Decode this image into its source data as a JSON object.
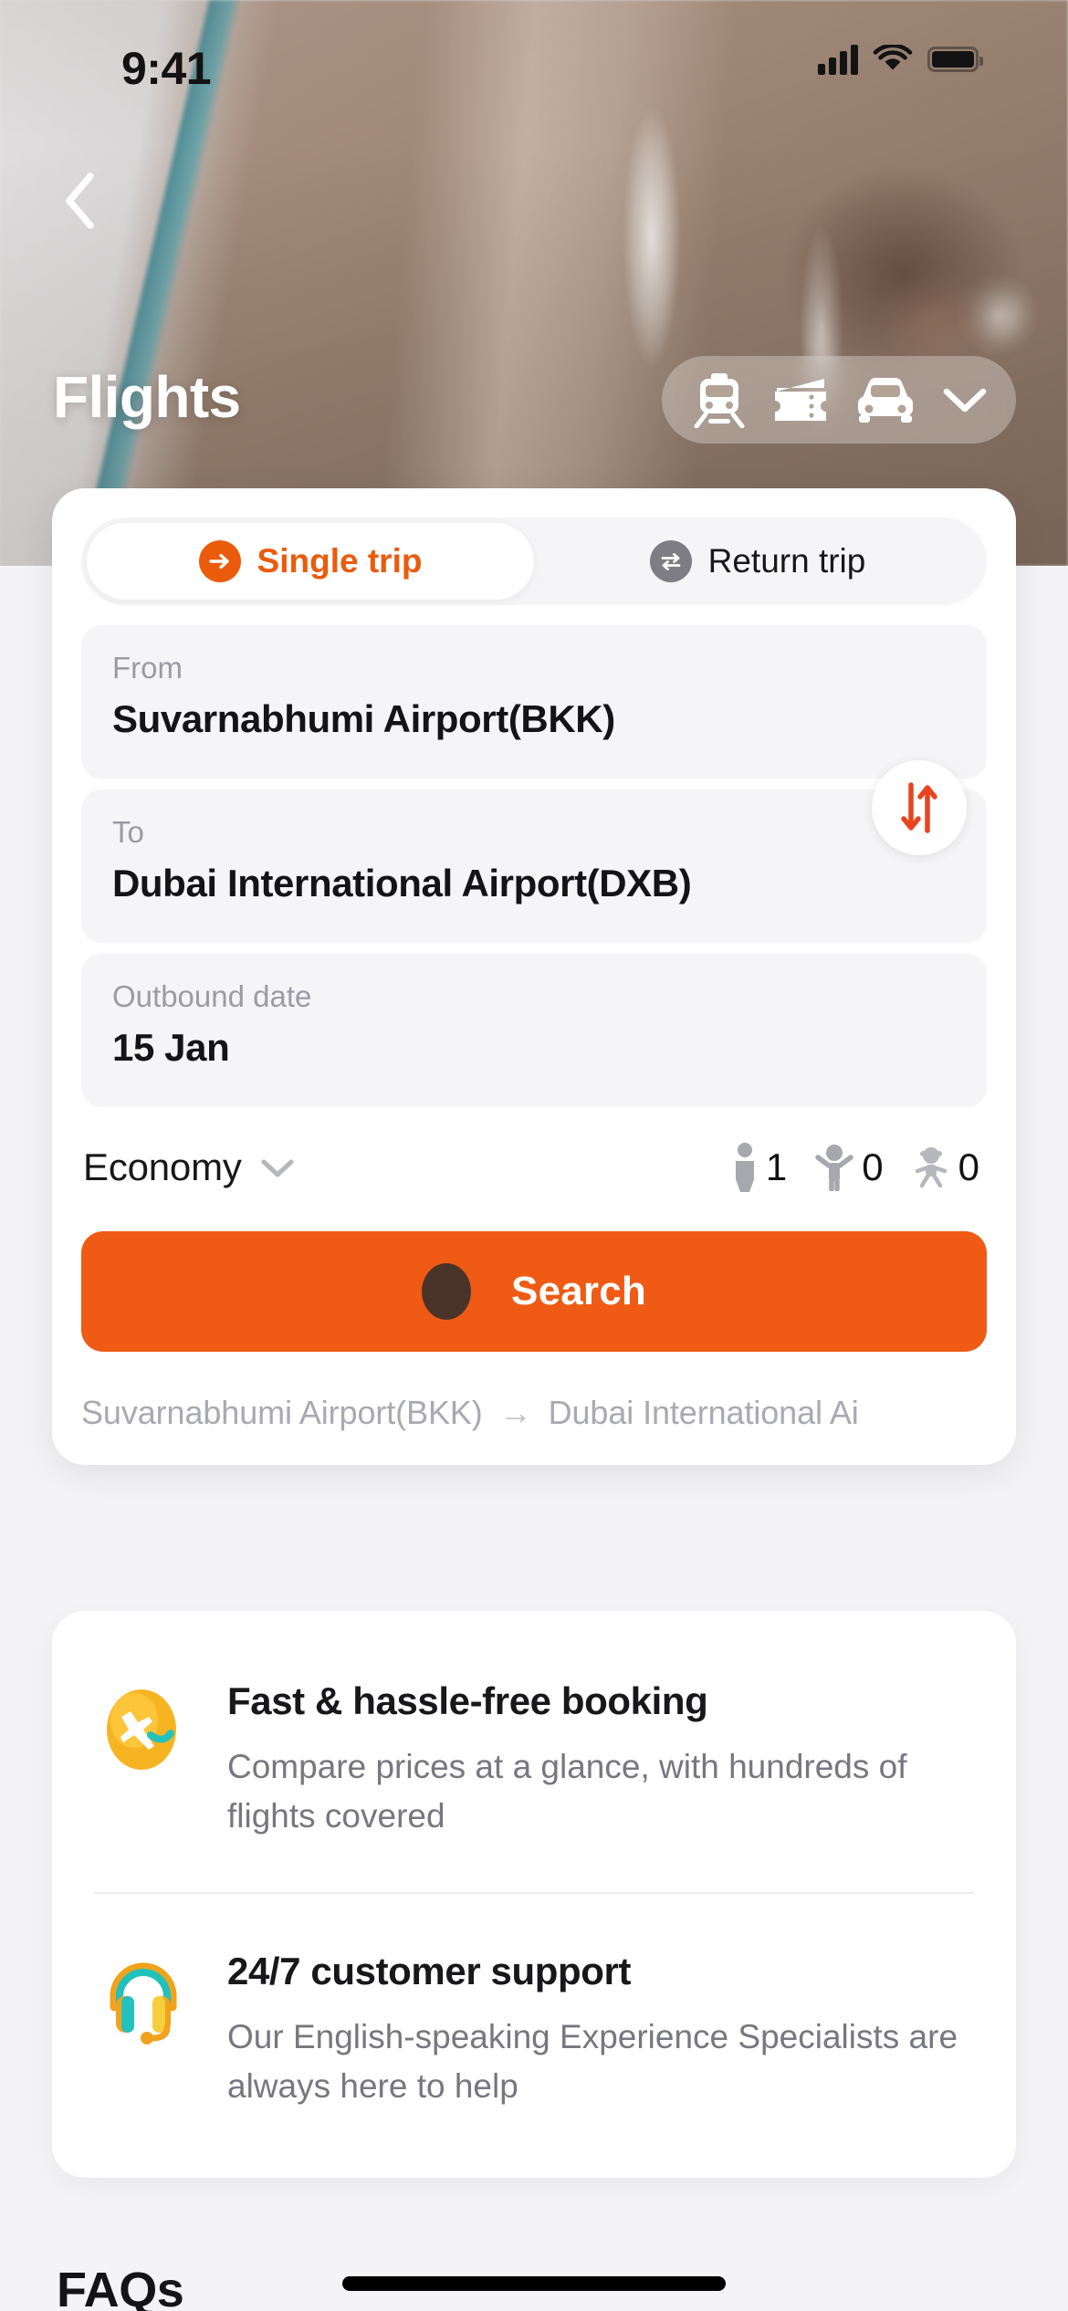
{
  "status_bar": {
    "time": "9:41",
    "signal_icon": "cellular-signal-icon",
    "wifi_icon": "wifi-icon",
    "battery_icon": "battery-full-icon"
  },
  "header": {
    "back_icon": "back-chevron-icon",
    "title": "Flights",
    "mode_selector": {
      "icons": [
        "train-icon",
        "ticket-icon",
        "car-icon"
      ],
      "expand_icon": "chevron-down-icon"
    }
  },
  "search_form": {
    "trip_types": [
      {
        "label": "Single trip",
        "icon": "arrow-right-circle-icon",
        "active": true
      },
      {
        "label": "Return trip",
        "icon": "swap-horizontal-circle-icon",
        "active": false
      }
    ],
    "from": {
      "label": "From",
      "value": "Suvarnabhumi Airport(BKK)"
    },
    "to": {
      "label": "To",
      "value": "Dubai International Airport(DXB)"
    },
    "swap_icon": "swap-vertical-icon",
    "date": {
      "label": "Outbound date",
      "value": "15 Jan"
    },
    "cabin_class": {
      "value": "Economy",
      "chevron_icon": "chevron-down-icon"
    },
    "passengers": [
      {
        "type": "adult",
        "icon": "adult-icon",
        "count": "1"
      },
      {
        "type": "child",
        "icon": "child-icon",
        "count": "0"
      },
      {
        "type": "infant",
        "icon": "infant-icon",
        "count": "0"
      }
    ],
    "search_button": {
      "label": "Search"
    },
    "recent_search": {
      "origin": "Suvarnabhumi Airport(BKK)",
      "arrow": "→",
      "destination": "Dubai International Ai"
    }
  },
  "benefits": [
    {
      "icon": "airplane-badge-icon",
      "title": "Fast & hassle-free booking",
      "description": "Compare prices at a glance, with hundreds of flights covered"
    },
    {
      "icon": "headset-support-icon",
      "title": "24/7 customer support",
      "description": "Our English-speaking Experience Specialists are always here to help"
    }
  ],
  "faq": {
    "title": "FAQs"
  },
  "colors": {
    "accent_orange": "#ef5b14",
    "accent_orange_text": "#ea5b0c",
    "swap_red": "#e8441f",
    "page_bg": "#f4f4f7",
    "card_bg": "#ffffff",
    "field_bg": "#f5f5f7",
    "muted_text": "#9b9ba3",
    "body_text": "#18181b",
    "touch_indicator": "#4a342a"
  }
}
